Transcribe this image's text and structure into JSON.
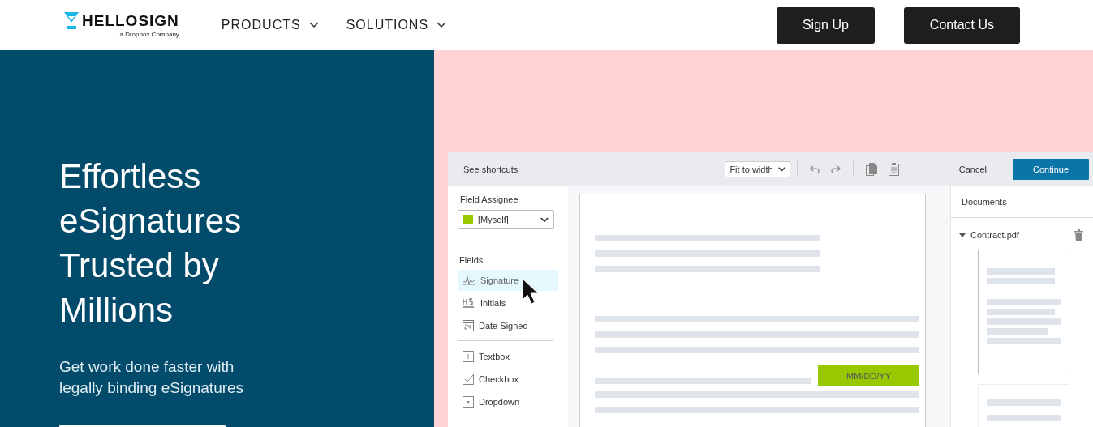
{
  "header": {
    "logo": {
      "name": "HELLOSIGN",
      "tagline": "a Dropbox Company"
    },
    "nav": [
      {
        "label": "PRODUCTS"
      },
      {
        "label": "SOLUTIONS"
      }
    ],
    "buttons": [
      "Sign Up",
      "Contact Us"
    ]
  },
  "hero": {
    "title": "Effortless eSignatures Trusted by Millions",
    "subtitle": "Get work done faster with legally binding eSignatures"
  },
  "editor": {
    "toolbar": {
      "shortcuts": "See shortcuts",
      "zoom": "Fit to width",
      "cancel": "Cancel",
      "continue": "Continue"
    },
    "sidebar": {
      "assignee_label": "Field Assignee",
      "assignee": {
        "value": "[Myself]",
        "color": "#97c800"
      },
      "fields_label": "Fields",
      "field_groups": [
        [
          {
            "kind": "signature",
            "label": "Signature",
            "selected": true
          },
          {
            "kind": "initials",
            "label": "Initials",
            "selected": false
          },
          {
            "kind": "date",
            "label": "Date Signed",
            "selected": false
          }
        ],
        [
          {
            "kind": "textbox",
            "label": "Textbox",
            "selected": false
          },
          {
            "kind": "checkbox",
            "label": "Checkbox",
            "selected": false
          },
          {
            "kind": "dropdown",
            "label": "Dropdown",
            "selected": false
          }
        ]
      ]
    },
    "document": {
      "date_field": "MM/DD/YY"
    },
    "documents": {
      "title": "Documents",
      "files": [
        {
          "name": "Contract.pdf",
          "expanded": true
        }
      ]
    }
  }
}
